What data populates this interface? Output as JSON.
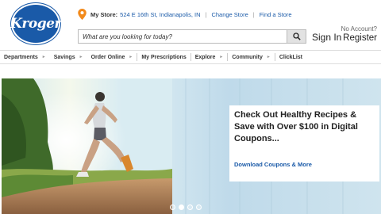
{
  "brand": {
    "logo_text": "Kroger",
    "color": "#1a5aa8"
  },
  "store": {
    "label": "My Store:",
    "address": "524 E 16th St, Indianapolis, IN",
    "change_link": "Change Store",
    "find_link": "Find a Store",
    "icon": "map-pin-icon",
    "icon_color": "#f28a1b"
  },
  "search": {
    "placeholder": "What are you looking for today?",
    "icon": "search-icon"
  },
  "account": {
    "sign_in": "Sign In",
    "no_account": "No Account?",
    "register": "Register"
  },
  "nav": [
    {
      "label": "Departments",
      "arrow": "►"
    },
    {
      "label": "Savings",
      "arrow": "►"
    },
    {
      "label": "Order Online",
      "arrow": "►"
    },
    {
      "label": "My Prescriptions",
      "arrow": ""
    },
    {
      "label": "Explore",
      "arrow": "►"
    },
    {
      "label": "Community",
      "arrow": "►"
    },
    {
      "label": "ClickList",
      "arrow": ""
    }
  ],
  "hero": {
    "headline": "Check Out Healthy Recipes & Save with Over $100 in Digital Coupons...",
    "cta": "Download Coupons & More",
    "slides": 4,
    "active_slide": 2
  }
}
